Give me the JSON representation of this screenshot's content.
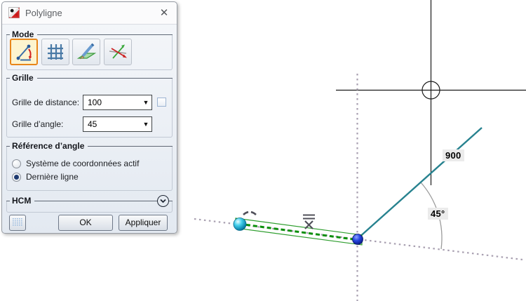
{
  "window": {
    "title": "Polyligne",
    "close_icon": "✕"
  },
  "mode": {
    "label": "Mode",
    "buttons": [
      {
        "icon": "polyline-angle-icon",
        "active": true
      },
      {
        "icon": "grid-icon",
        "active": false
      },
      {
        "icon": "pencil-plane-icon",
        "active": false
      },
      {
        "icon": "axis-arrows-icon",
        "active": false
      }
    ]
  },
  "grille": {
    "label": "Grille",
    "rows": [
      {
        "label": "Grille de distance:",
        "value": "100"
      },
      {
        "label": "Grille d’angle:",
        "value": "45"
      }
    ]
  },
  "reference": {
    "label": "Référence d’angle",
    "options": [
      {
        "label": "Système de coordonnées actif",
        "selected": false
      },
      {
        "label": "Dernière ligne",
        "selected": true
      }
    ]
  },
  "hcm": {
    "label": "HCM"
  },
  "footer": {
    "ok": "OK",
    "apply": "Appliquer"
  },
  "canvas": {
    "length_label": "900",
    "angle_label": "45°",
    "colors": {
      "teal_line": "#27828F",
      "green_polyline": "#0A8F0A",
      "dotted_guide": "#A89FB0",
      "angle_arc": "#9B9B9B",
      "active_mode_border": "#E8861A",
      "radio_dot": "#1E3A70",
      "label_background": "#EBEBEB"
    }
  }
}
